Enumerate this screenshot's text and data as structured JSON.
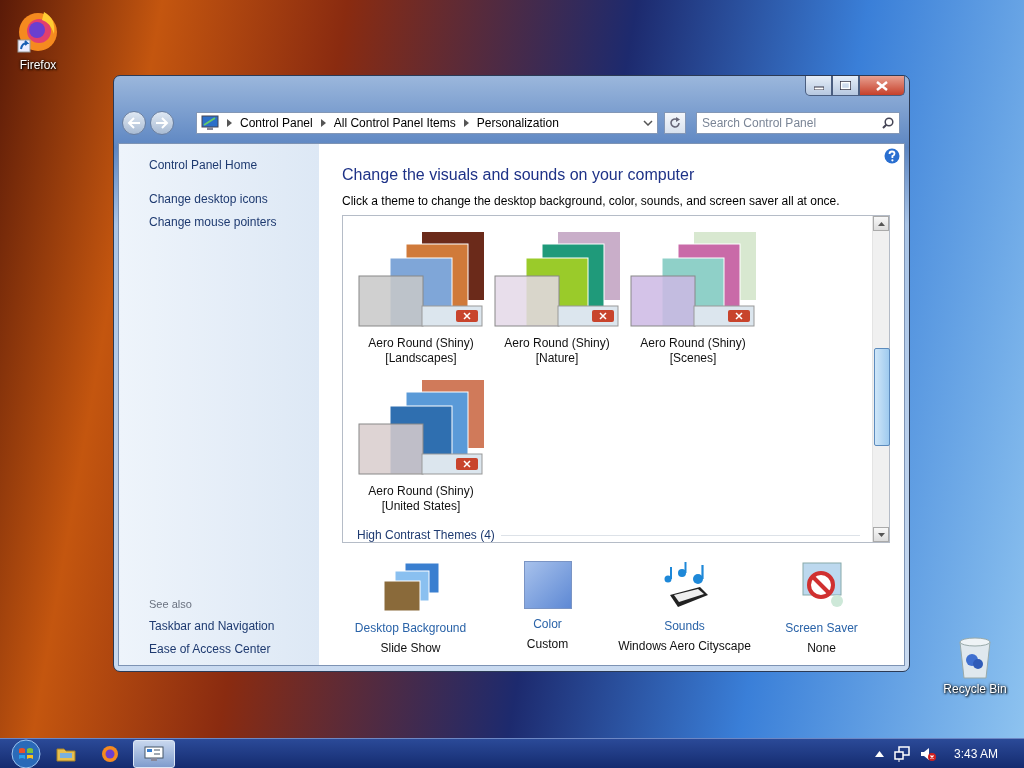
{
  "desktop_icons": [
    {
      "kind": "firefox",
      "label": "Firefox"
    },
    {
      "kind": "recycle",
      "label": "Recycle Bin"
    }
  ],
  "window": {
    "address": [
      "Control Panel",
      "All Control Panel Items",
      "Personalization"
    ],
    "search": {
      "placeholder": "Search Control Panel"
    }
  },
  "sidebar": {
    "links": [
      "Control Panel Home",
      "Change desktop icons",
      "Change mouse pointers"
    ],
    "see_also_heading": "See also",
    "see_also": [
      "Taskbar and Navigation",
      "Ease of Access Center"
    ]
  },
  "content": {
    "title": "Change the visuals and sounds on your computer",
    "subtitle": "Click a theme to change the desktop background, color, sounds, and screen saver all at once.",
    "themes": [
      {
        "name": "Aero Round (Shiny)",
        "tag": "[Landscapes]",
        "selected": false
      },
      {
        "name": "Aero Round (Shiny)",
        "tag": "[Nature]",
        "selected": false
      },
      {
        "name": "Aero Round (Shiny)",
        "tag": "[Scenes]",
        "selected": false
      },
      {
        "name": "Aero Round (Shiny)",
        "tag": "[United States]",
        "selected": false
      }
    ],
    "section": "High Contrast Themes (4)",
    "settings": [
      {
        "kind": "background",
        "label": "Desktop Background",
        "value": "Slide Show"
      },
      {
        "kind": "color",
        "label": "Color",
        "value": "Custom"
      },
      {
        "kind": "sounds",
        "label": "Sounds",
        "value": "Windows Aero Cityscape"
      },
      {
        "kind": "screensaver",
        "label": "Screen Saver",
        "value": "None"
      }
    ]
  },
  "taskbar": {
    "buttons": [
      {
        "kind": "explorer",
        "selected": false
      },
      {
        "kind": "firefox",
        "selected": false
      },
      {
        "kind": "control-panel",
        "selected": true
      }
    ],
    "clock": "3:43 AM"
  }
}
